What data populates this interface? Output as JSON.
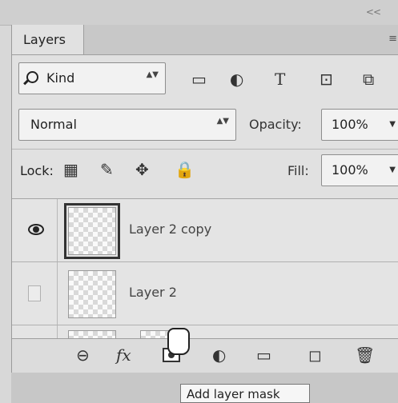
{
  "app": {
    "collapse_glyph": "<<"
  },
  "panel": {
    "tab": "Layers",
    "menu_glyph": "≡"
  },
  "filter": {
    "kind_label": "Kind",
    "stepper": "▲▼",
    "icons": [
      "image-icon",
      "adjustment-icon",
      "type-icon",
      "shape-icon",
      "smart-object-icon"
    ],
    "type_glyph": "T"
  },
  "blend": {
    "mode": "Normal",
    "opacity_label": "Opacity:",
    "opacity_value": "100%"
  },
  "lock": {
    "label": "Lock:",
    "fill_label": "Fill:",
    "fill_value": "100%"
  },
  "layers": [
    {
      "name": "Layer 2 copy",
      "visible": true,
      "selected": true
    },
    {
      "name": "Layer 2",
      "visible": false,
      "selected": false
    }
  ],
  "bottom": {
    "link_glyph": "⊖",
    "fx_label": "fx",
    "tooltip": "Add layer mask"
  }
}
